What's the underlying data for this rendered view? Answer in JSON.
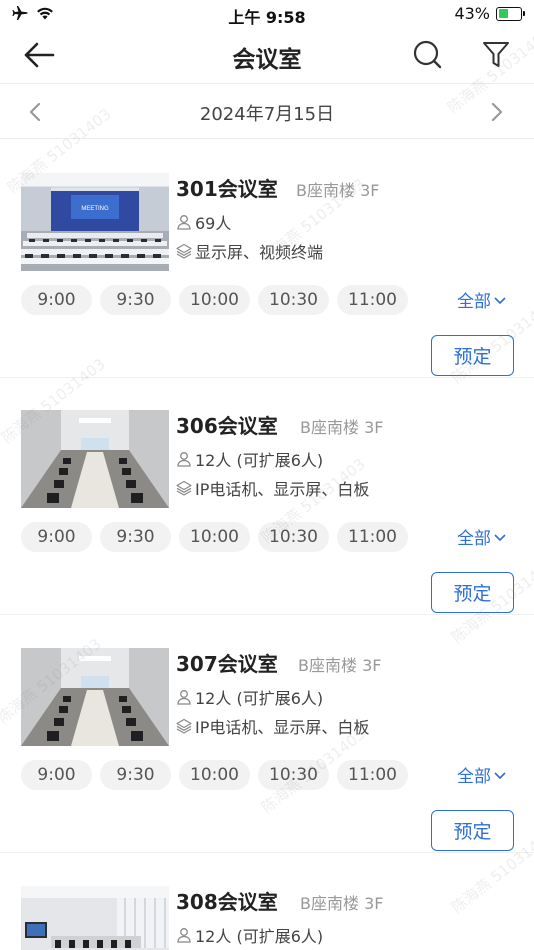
{
  "status_bar": {
    "time": "上午 9:58",
    "battery_percent": "43%",
    "battery_level": 0.43
  },
  "nav": {
    "title": "会议室"
  },
  "date_bar": {
    "date": "2024年7月15日"
  },
  "rooms": [
    {
      "name": "301会议室",
      "location": "B座南楼 3F",
      "capacity": "69人",
      "equipment": "显示屏、视频终端",
      "slots": [
        "9:00",
        "9:30",
        "10:00",
        "10:30",
        "11:00"
      ],
      "all_label": "全部",
      "book_label": "预定",
      "screen_text": "MEETING"
    },
    {
      "name": "306会议室",
      "location": "B座南楼 3F",
      "capacity": "12人 (可扩展6人)",
      "equipment": "IP电话机、显示屏、白板",
      "slots": [
        "9:00",
        "9:30",
        "10:00",
        "10:30",
        "11:00"
      ],
      "all_label": "全部",
      "book_label": "预定"
    },
    {
      "name": "307会议室",
      "location": "B座南楼 3F",
      "capacity": "12人 (可扩展6人)",
      "equipment": "IP电话机、显示屏、白板",
      "slots": [
        "9:00",
        "9:30",
        "10:00",
        "10:30",
        "11:00"
      ],
      "all_label": "全部",
      "book_label": "预定"
    },
    {
      "name": "308会议室",
      "location": "B座南楼 3F",
      "capacity": "12人 (可扩展6人)"
    }
  ],
  "watermark": {
    "text": "陈海燕 51031403"
  },
  "colors": {
    "accent": "#2d6fd6",
    "slot_bg": "#f2f2f2",
    "location": "#999999"
  }
}
